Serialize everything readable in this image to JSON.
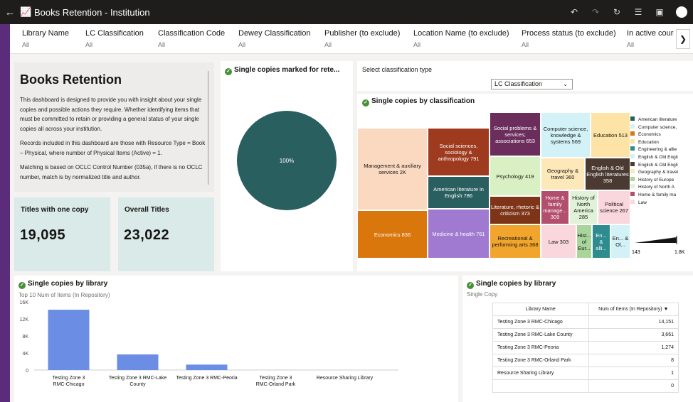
{
  "window": {
    "title": "Books Retention - Institution"
  },
  "filters": [
    {
      "label": "Library Name",
      "value": "All"
    },
    {
      "label": "LC Classification",
      "value": "All"
    },
    {
      "label": "Classification Code",
      "value": "All"
    },
    {
      "label": "Dewey Classification",
      "value": "All"
    },
    {
      "label": "Publisher (to exclude)",
      "value": "All"
    },
    {
      "label": "Location Name (to exclude)",
      "value": "All"
    },
    {
      "label": "Process status (to exclude)",
      "value": "All"
    },
    {
      "label": "In active course",
      "value": "All"
    }
  ],
  "intro": {
    "title": "Books Retention",
    "paragraphs": [
      "This dashboard is designed to provide you with insight about your single copies and possible actions they require. Whether identifying items that must be committed to retain or providing a general status of your single copies all across your institution.",
      "Records included in this dashboard are those with Resource Type = Book – Physical, where number of Physical Items (Active) = 1.",
      "Matching is based on OCLC Control Number (035a), if there is no OCLC number, match is by normalized title and author."
    ]
  },
  "kpis": [
    {
      "label": "Titles with one copy",
      "value": "19,095"
    },
    {
      "label": "Overall Titles",
      "value": "23,022"
    }
  ],
  "pie": {
    "title": "Single copies marked for rete...",
    "label": "100%",
    "color": "#2a5f60"
  },
  "classification_select": {
    "label": "Select classification type",
    "value": "LC Classification"
  },
  "treemap": {
    "title": "Single copies by classification",
    "tiles": [
      {
        "label": "Management & auxiliary services 2K",
        "color": "#fbd9c1",
        "text": "#161513"
      },
      {
        "label": "Economics 836",
        "color": "#d9770d",
        "text": "#ffffff"
      },
      {
        "label": "Social sciences, sociology & anthropology 791",
        "color": "#9e3b1f",
        "text": "#ffffff"
      },
      {
        "label": "American literature in English 786",
        "color": "#2a5f60",
        "text": "#ffffff"
      },
      {
        "label": "Medicine & health 761",
        "color": "#9f7ad0",
        "text": "#ffffff"
      },
      {
        "label": "Social problems & services; associations 653",
        "color": "#6b2d5c",
        "text": "#ffffff"
      },
      {
        "label": "Psychology 419",
        "color": "#d9f0c4",
        "text": "#161513"
      },
      {
        "label": "Literature, rhetoric & criticism 373",
        "color": "#7d3417",
        "text": "#ffffff"
      },
      {
        "label": "Recreational & performing arts 368",
        "color": "#f2a52c",
        "text": "#161513"
      },
      {
        "label": "Computer science, knowledge & systems 569",
        "color": "#d2f2f8",
        "text": "#161513"
      },
      {
        "label": "Education 513",
        "color": "#fde4a6",
        "text": "#161513"
      },
      {
        "label": "Geography & travel 360",
        "color": "#fde8b9",
        "text": "#161513"
      },
      {
        "label": "English & Old English literatures 358",
        "color": "#4a3a32",
        "text": "#ffffff"
      },
      {
        "label": "Home & family manage... 309",
        "color": "#b34f6e",
        "text": "#ffffff"
      },
      {
        "label": "History of North America 285",
        "color": "#e0f2d8",
        "text": "#161513"
      },
      {
        "label": "Political science 267",
        "color": "#fad6dd",
        "text": "#161513"
      },
      {
        "label": "Law 303",
        "color": "#fad6dd",
        "text": "#161513"
      },
      {
        "label": "Hist... of Eur...",
        "color": "#a8d59a",
        "text": "#161513"
      },
      {
        "label": "En... & alli...",
        "color": "#2e8b8f",
        "text": "#ffffff"
      },
      {
        "label": "En... & Ol...",
        "color": "#d2f2f8",
        "text": "#161513"
      }
    ],
    "legend": [
      {
        "label": "American literature",
        "color": "#2a5f60"
      },
      {
        "label": "Computer science,",
        "color": "#d2f2f8"
      },
      {
        "label": "Economics",
        "color": "#d9770d"
      },
      {
        "label": "Education",
        "color": "#fde4a6"
      },
      {
        "label": "Engineering & allie",
        "color": "#2e8b8f"
      },
      {
        "label": "English & Old Engli",
        "color": "#d2f2f8"
      },
      {
        "label": "English & Old Engli",
        "color": "#4a3a32"
      },
      {
        "label": "Geography & travel",
        "color": "#fde8b9"
      },
      {
        "label": "History of Europe",
        "color": "#a8d59a"
      },
      {
        "label": "History of North A",
        "color": "#e0f2d8"
      },
      {
        "label": "Home & family ma",
        "color": "#b34f6e"
      },
      {
        "label": "Law",
        "color": "#fad6dd"
      }
    ],
    "range": {
      "min": "143",
      "max": "1.8K"
    }
  },
  "bar_section": {
    "title": "Single copies by library",
    "subtitle": "Top 10 Num of Items (In Repository)"
  },
  "table_section": {
    "title": "Single copies by library",
    "subtitle": "Single Copy",
    "headers": [
      "Library Name",
      "Num of Items (In Repository) ▼"
    ],
    "rows": [
      [
        "Testing Zone 3 RMC-Chicago",
        "14,151"
      ],
      [
        "Testing Zone 3 RMC-Lake County",
        "3,661"
      ],
      [
        "Testing Zone 3 RMC-Peoria",
        "1,274"
      ],
      [
        "Testing Zone 3 RMC-Orland Park",
        "8"
      ],
      [
        "Resource Sharing Library",
        "1"
      ],
      [
        "",
        "0"
      ]
    ]
  },
  "chart_data": {
    "type": "bar",
    "title": "Single copies by library",
    "subtitle": "Top 10 Num of Items (In Repository)",
    "categories": [
      "Testing Zone 3 RMC-Chicago",
      "Testing Zone 3 RMC-Lake County",
      "Testing Zone 3 RMC-Peoria",
      "Testing Zone 3 RMC-Orland Park",
      "Resource Sharing Library"
    ],
    "category_labels": [
      [
        "Testing Zone 3",
        "RMC-Chicago"
      ],
      [
        "Testing Zone 3 RMC-Lake",
        "County"
      ],
      [
        "Testing Zone 3 RMC-Peoria"
      ],
      [
        "Testing Zone 3",
        "RMC-Orland Park"
      ],
      [
        "Resource Sharing Library"
      ]
    ],
    "values": [
      14151,
      3661,
      1274,
      8,
      1
    ],
    "yticks": [
      "0",
      "4K",
      "8K",
      "12K",
      "16K"
    ],
    "ylim": [
      0,
      16000
    ],
    "bar_color": "#6b8de3",
    "grid": false
  }
}
